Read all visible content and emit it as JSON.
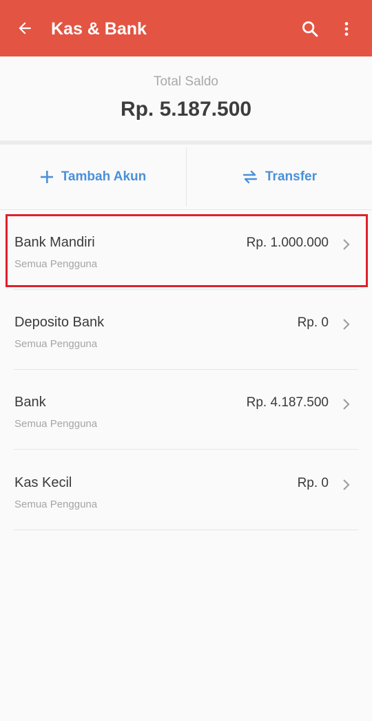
{
  "header": {
    "title": "Kas & Bank",
    "background_color": "#e35443",
    "back_icon": "arrow-left-icon",
    "search_icon": "search-icon",
    "more_icon": "more-vertical-icon"
  },
  "summary": {
    "label": "Total Saldo",
    "total": "Rp. 5.187.500"
  },
  "actions": {
    "add_account_label": "Tambah Akun",
    "transfer_label": "Transfer",
    "accent_color": "#4a90d9"
  },
  "accounts": [
    {
      "name": "Bank Mandiri",
      "subtitle": "Semua Pengguna",
      "amount": "Rp. 1.000.000",
      "highlighted": true
    },
    {
      "name": "Deposito Bank",
      "subtitle": "Semua Pengguna",
      "amount": "Rp. 0"
    },
    {
      "name": "Bank",
      "subtitle": "Semua Pengguna",
      "amount": "Rp. 4.187.500"
    },
    {
      "name": "Kas Kecil",
      "subtitle": "Semua Pengguna",
      "amount": "Rp. 0"
    }
  ],
  "highlight_color": "#e0202a"
}
